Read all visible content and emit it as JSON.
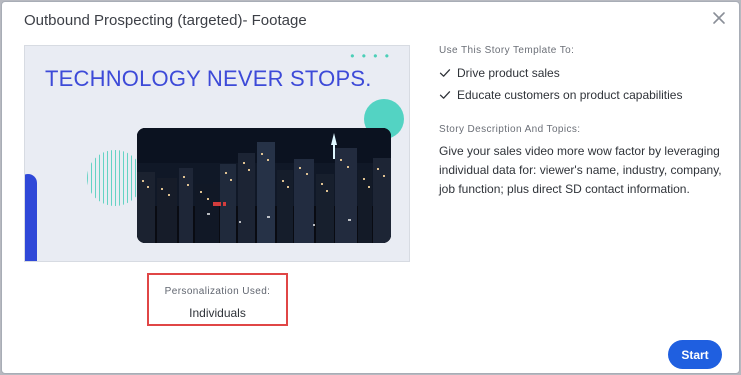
{
  "modal": {
    "title": "Outbound Prospecting (targeted)- Footage",
    "close_icon": "close-icon"
  },
  "thumbnail": {
    "headline": "TECHNOLOGY NEVER STOPS.",
    "dots": "• • • •",
    "accent_colors": {
      "headline": "#3d4ad8",
      "teal": "#53d3c3",
      "blue": "#2f48d8"
    }
  },
  "personalization": {
    "label": "Personalization Used:",
    "value": "Individuals",
    "highlight_color": "#e04646"
  },
  "template_info": {
    "purpose_label": "Use This Story Template To:",
    "purpose_items": [
      {
        "icon": "check-icon",
        "label": "Drive product sales"
      },
      {
        "icon": "check-icon",
        "label": "Educate customers on product capabilities"
      }
    ],
    "description_label": "Story Description And Topics:",
    "description_text": "Give your sales video more wow factor by leveraging individual data for: viewer's name, industry, company, job function; plus direct SD contact information."
  },
  "actions": {
    "start_label": "Start",
    "start_color": "#1f5fe0"
  }
}
